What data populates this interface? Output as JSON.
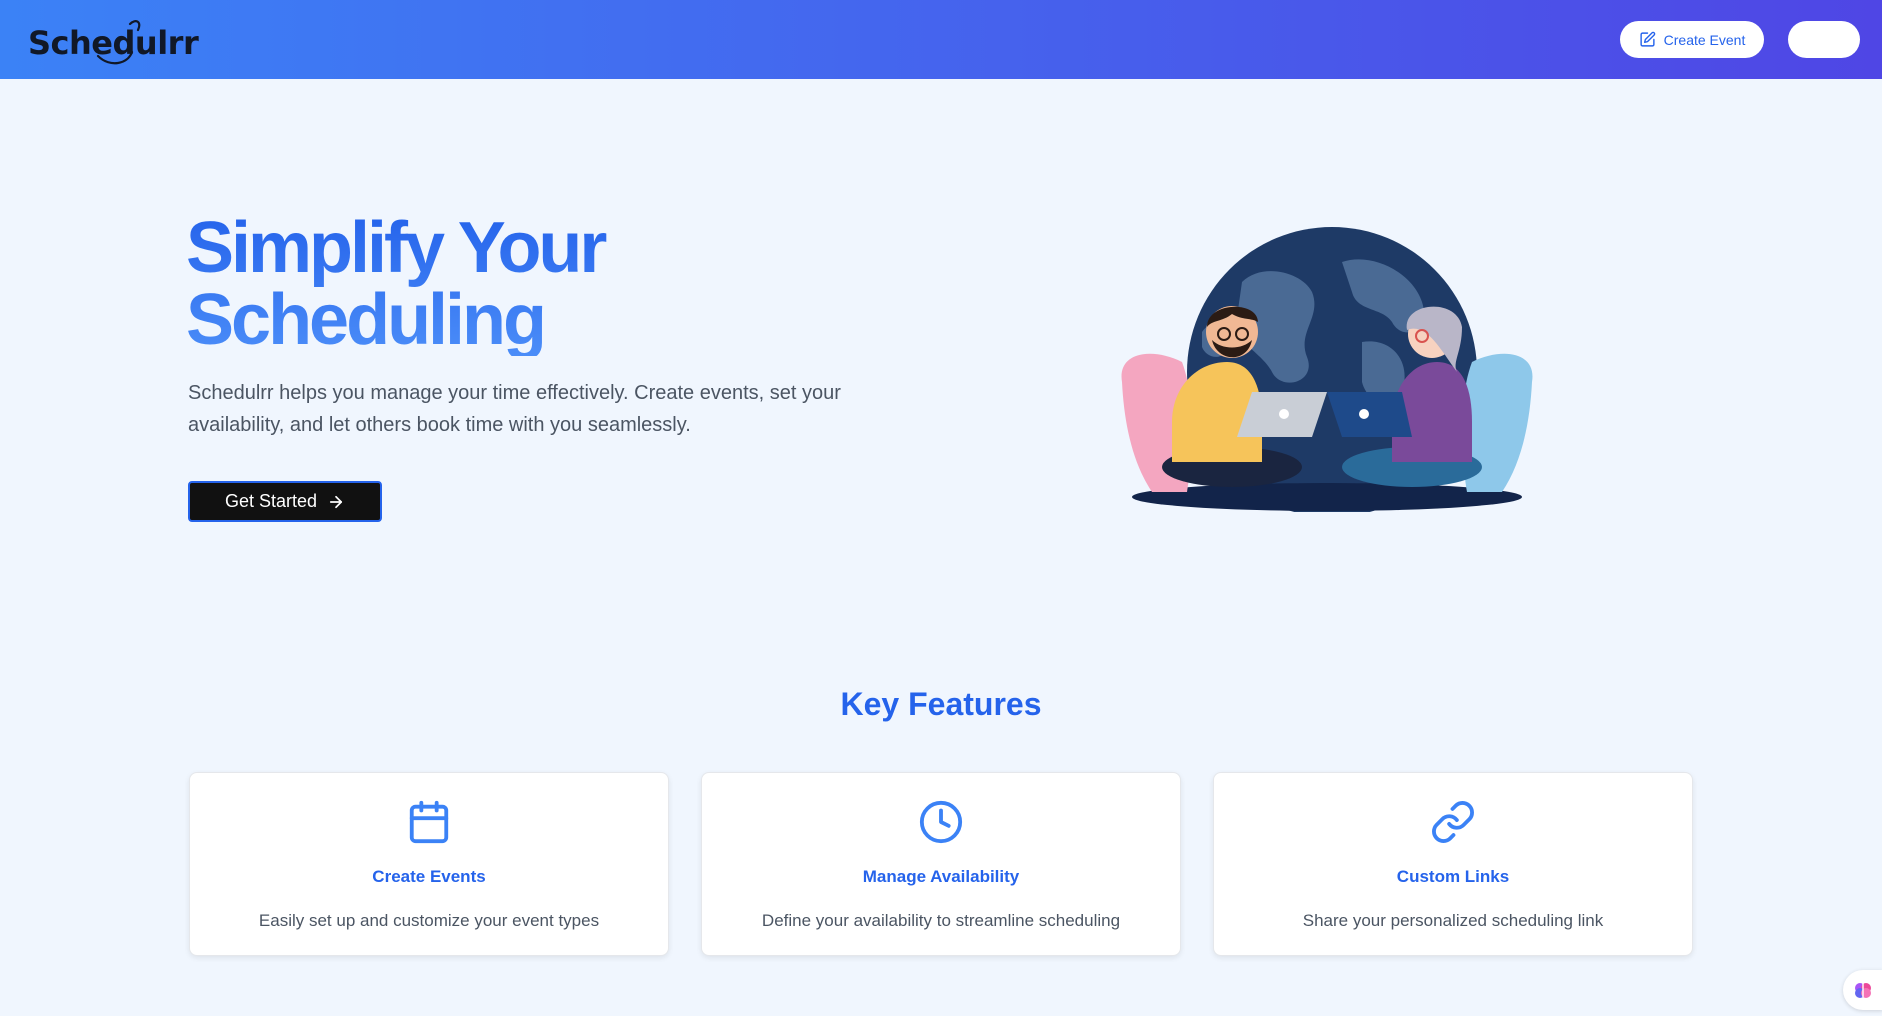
{
  "header": {
    "logo_text": "Schedulrr",
    "create_event_label": "Create Event",
    "create_event_icon": "pen-square-icon",
    "user_button_label": ""
  },
  "hero": {
    "title_line1": "Simplify Your",
    "title_line2": "Scheduling",
    "description": "Schedulrr helps you manage your time effectively. Create events, set your availability, and let others book time with you seamlessly.",
    "cta_label": "Get Started",
    "cta_icon": "arrow-right-icon"
  },
  "features": {
    "title": "Key Features",
    "items": [
      {
        "icon": "calendar-icon",
        "title": "Create Events",
        "description": "Easily set up and customize your event types"
      },
      {
        "icon": "clock-icon",
        "title": "Manage Availability",
        "description": "Define your availability to streamline scheduling"
      },
      {
        "icon": "link-icon",
        "title": "Custom Links",
        "description": "Share your personalized scheduling link"
      }
    ]
  },
  "colors": {
    "header_gradient_start": "#3b82f6",
    "header_gradient_end": "#4f46e5",
    "accent": "#2563eb",
    "page_background": "#f0f6fe",
    "cta_background": "#111111"
  }
}
